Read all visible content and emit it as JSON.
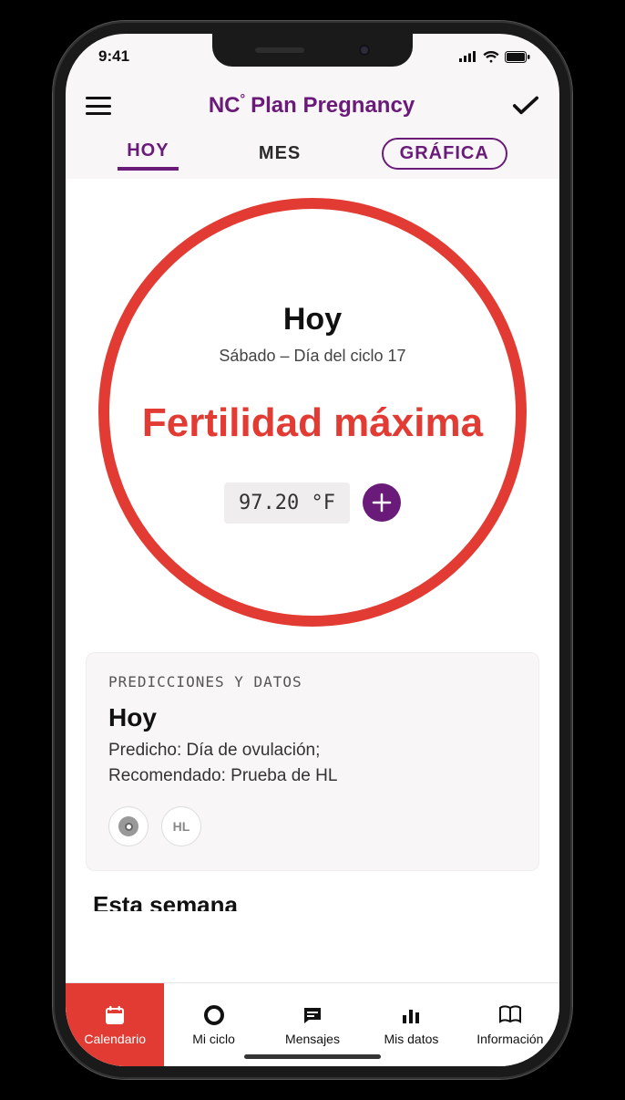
{
  "status": {
    "time": "9:41"
  },
  "header": {
    "logo_prefix": "NC",
    "logo_degree": "°",
    "title_rest": "Plan Pregnancy"
  },
  "tabs": {
    "today": "HOY",
    "month": "MES",
    "chart": "GRÁFICA"
  },
  "circle": {
    "today": "Hoy",
    "subtitle": "Sábado – Día del ciclo 17",
    "fertility": "Fertilidad máxima",
    "temperature": "97.20 °F"
  },
  "card": {
    "label": "PREDICCIONES Y DATOS",
    "title": "Hoy",
    "line1": "Predicho: Día de ovulación;",
    "line2": "Recomendado: Prueba de HL",
    "hl_badge": "HL"
  },
  "cutoff_preview": "Esta semana",
  "nav": {
    "calendar": "Calendario",
    "cycle": "Mi ciclo",
    "messages": "Mensajes",
    "data": "Mis datos",
    "info": "Información"
  },
  "colors": {
    "accent_red": "#e23b33",
    "accent_purple": "#6a1b7a"
  }
}
